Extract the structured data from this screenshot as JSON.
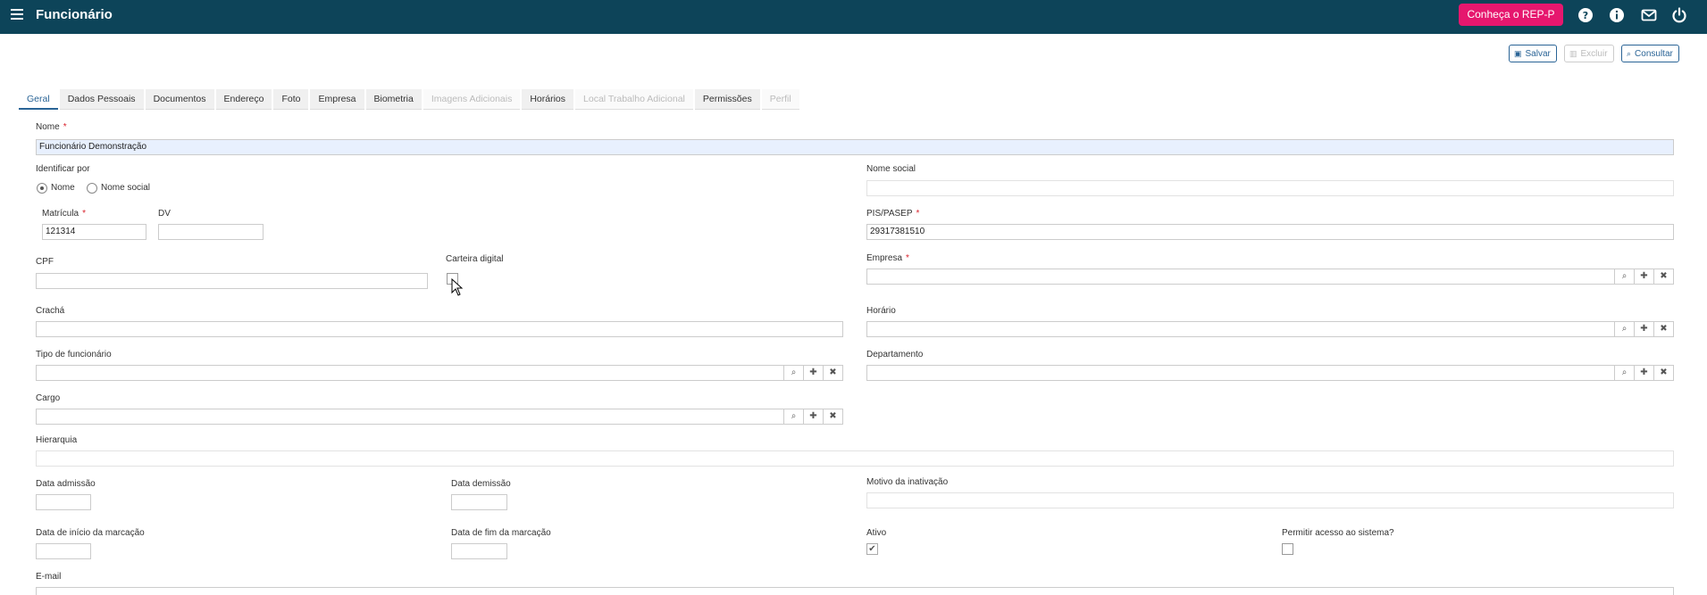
{
  "header": {
    "title": "Funcionário",
    "rep_button": "Conheça o REP-P",
    "icons": [
      "help-icon",
      "info-icon",
      "mail-icon",
      "power-icon"
    ]
  },
  "toolbar": {
    "save": "Salvar",
    "delete": "Excluir",
    "query": "Consultar"
  },
  "tabs": [
    {
      "label": "Geral",
      "state": "active"
    },
    {
      "label": "Dados Pessoais",
      "state": "normal"
    },
    {
      "label": "Documentos",
      "state": "normal"
    },
    {
      "label": "Endereço",
      "state": "normal"
    },
    {
      "label": "Foto",
      "state": "normal"
    },
    {
      "label": "Empresa",
      "state": "normal"
    },
    {
      "label": "Biometria",
      "state": "normal"
    },
    {
      "label": "Imagens Adicionais",
      "state": "disabled"
    },
    {
      "label": "Horários",
      "state": "normal"
    },
    {
      "label": "Local Trabalho Adicional",
      "state": "disabled"
    },
    {
      "label": "Permissões",
      "state": "normal"
    },
    {
      "label": "Perfil",
      "state": "disabled"
    }
  ],
  "form": {
    "nome": {
      "label": "Nome",
      "value": "Funcionário Demonstração"
    },
    "identificar_por": {
      "label": "Identificar por",
      "options": [
        "Nome",
        "Nome social"
      ],
      "selected": "Nome"
    },
    "nome_social": {
      "label": "Nome social",
      "value": ""
    },
    "matricula": {
      "label": "Matrícula",
      "value": "121314"
    },
    "dv": {
      "label": "DV",
      "value": ""
    },
    "pis_pasep": {
      "label": "PIS/PASEP",
      "value": "29317381510"
    },
    "cpf": {
      "label": "CPF",
      "value": ""
    },
    "carteira_digital": {
      "label": "Carteira digital",
      "checked": false
    },
    "empresa": {
      "label": "Empresa",
      "value": ""
    },
    "cracha": {
      "label": "Crachá",
      "value": ""
    },
    "horario": {
      "label": "Horário",
      "value": ""
    },
    "tipo_funcionario": {
      "label": "Tipo de funcionário",
      "value": ""
    },
    "departamento": {
      "label": "Departamento",
      "value": ""
    },
    "cargo": {
      "label": "Cargo",
      "value": ""
    },
    "hierarquia": {
      "label": "Hierarquia",
      "value": ""
    },
    "data_admissao": {
      "label": "Data admissão",
      "value": ""
    },
    "data_demissao": {
      "label": "Data demissão",
      "value": ""
    },
    "motivo_inativacao": {
      "label": "Motivo da inativação",
      "value": ""
    },
    "data_inicio_marcacao": {
      "label": "Data de início da marcação",
      "value": ""
    },
    "data_fim_marcacao": {
      "label": "Data de fim da marcação",
      "value": ""
    },
    "ativo": {
      "label": "Ativo",
      "checked": true
    },
    "permitir_acesso": {
      "label": "Permitir acesso ao sistema?",
      "checked": false
    },
    "email": {
      "label": "E-mail",
      "value": ""
    }
  },
  "colors": {
    "topbar": "#0d4459",
    "accent": "#2a6496",
    "rep_button": "#e6176e",
    "required": "#d9232d"
  }
}
